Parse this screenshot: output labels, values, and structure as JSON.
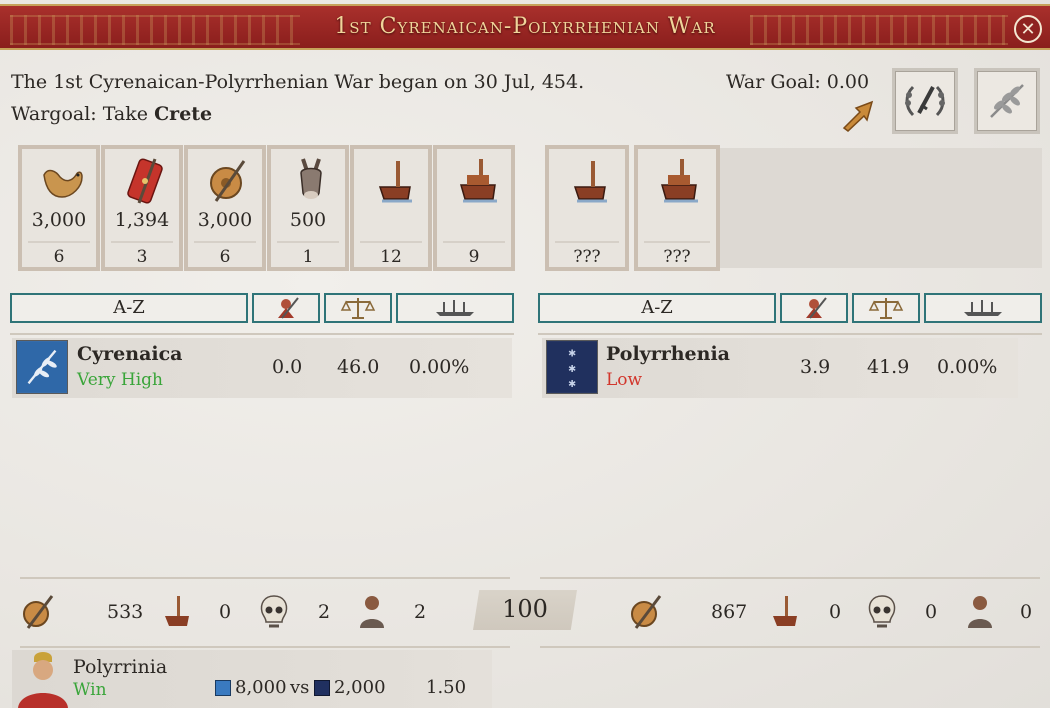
{
  "window": {
    "title": "1st Cyrenaican-Polyrrhenian War",
    "close_icon": "close-icon"
  },
  "header": {
    "description": "The 1st Cyrenaican-Polyrrhenian War began on 30 Jul, 454.",
    "wargoal_prefix": "Wargoal: Take ",
    "wargoal_target": "Crete",
    "war_goal_score": "War Goal: 0.00"
  },
  "attacker_units": [
    {
      "icon": "camel-icon",
      "value": "3,000",
      "count": "6"
    },
    {
      "icon": "legionary-shield-icon",
      "value": "1,394",
      "count": "3"
    },
    {
      "icon": "round-shield-icon",
      "value": "3,000",
      "count": "6"
    },
    {
      "icon": "donkey-icon",
      "value": "500",
      "count": "1"
    },
    {
      "icon": "light-ship-icon",
      "value": "",
      "count": "12"
    },
    {
      "icon": "heavy-ship-icon",
      "value": "",
      "count": "9"
    }
  ],
  "defender_units": [
    {
      "icon": "light-ship-icon",
      "value": "",
      "count": "???"
    },
    {
      "icon": "heavy-ship-icon",
      "value": "",
      "count": "???"
    }
  ],
  "columns": {
    "sort_label": "A-Z"
  },
  "attacker": {
    "name": "Cyrenaica",
    "status": "Very High",
    "military": "0.0",
    "score": "46.0",
    "share": "0.00%",
    "flag_color": "#2f68a8"
  },
  "defender": {
    "name": "Polyrrhenia",
    "status": "Low",
    "military": "3.9",
    "score": "41.9",
    "share": "0.00%",
    "flag_color": "#20305e"
  },
  "losses": {
    "attacker": {
      "infantry": "533",
      "ships": "0",
      "dead": "2",
      "captured": "2"
    },
    "defender": {
      "infantry": "867",
      "ships": "0",
      "dead": "0",
      "captured": "0"
    },
    "war_score": "100"
  },
  "battle": {
    "name": "Polyrrinia",
    "result": "Win",
    "attacker_strength": "8,000",
    "vs": "vs",
    "defender_strength": "2,000",
    "ratio": "1.50"
  }
}
